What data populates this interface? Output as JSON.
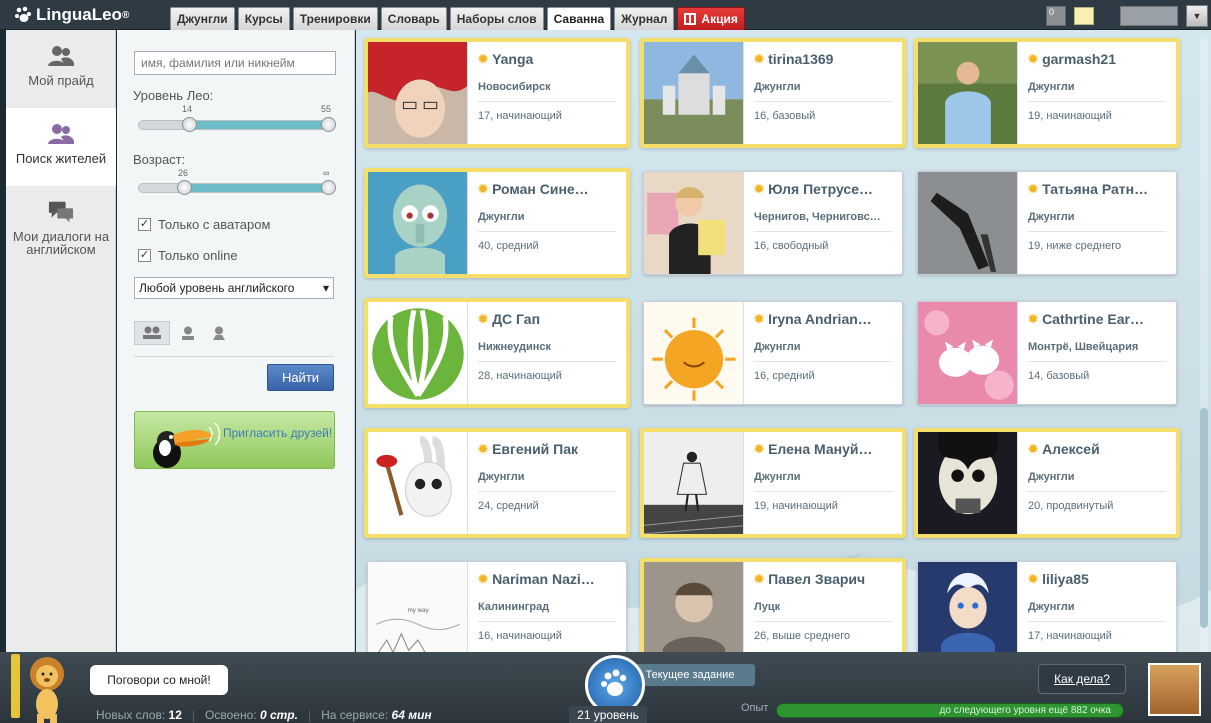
{
  "app": {
    "title": "LinguaLeo",
    "reg": "®"
  },
  "tabs": [
    {
      "label": "Джунгли"
    },
    {
      "label": "Курсы"
    },
    {
      "label": "Тренировки"
    },
    {
      "label": "Словарь"
    },
    {
      "label": "Наборы слов"
    },
    {
      "label": "Саванна"
    },
    {
      "label": "Журнал"
    },
    {
      "label": "Акция"
    }
  ],
  "topbar": {
    "notif_count": "0"
  },
  "nav": {
    "pride": "Мой прайд",
    "search": "Поиск жителей",
    "dialogs": "Мои диалоги на английском"
  },
  "filter": {
    "search_placeholder": "имя, фамилия или никнейм",
    "leo_label": "Уровень Лео:",
    "leo_min": "14",
    "leo_max": "55",
    "age_label": "Возраст:",
    "age_min": "26",
    "age_max": "∞",
    "with_avatar": "Только с аватаром",
    "only_online": "Только online",
    "english_level": "Любой уровень английского",
    "find": "Найти",
    "invite": "Пригласить друзей!"
  },
  "colors": {
    "gold_border": "#f5df6a",
    "accent_teal": "#6fbcc9",
    "button_blue": "#3a64a8",
    "promo_red": "#c11d1d",
    "xp_green": "#2e9432"
  },
  "people": [
    {
      "name": "Yanga",
      "city": "Новосибирск",
      "level": "17, начинающий",
      "gold": true,
      "photo": "anime-red-hair"
    },
    {
      "name": "tirina1369",
      "city": "Джунгли",
      "level": "16, базовый",
      "gold": true,
      "photo": "castle"
    },
    {
      "name": "garmash21",
      "city": "Джунгли",
      "level": "19, начинающий",
      "gold": true,
      "photo": "man-outdoor"
    },
    {
      "name": "Роман Сине…",
      "city": "Джунгли",
      "level": "40, средний",
      "gold": true,
      "photo": "squidward"
    },
    {
      "name": "Юля Петрусе…",
      "city": "Чернигов, Черниговс…",
      "level": "16, свободный",
      "gold": false,
      "photo": "girl-book"
    },
    {
      "name": "Татьяна Ратн…",
      "city": "Джунгли",
      "level": "19, ниже среднего",
      "gold": false,
      "photo": "heel-shoe"
    },
    {
      "name": "ДС Гап",
      "city": "Нижнеудинск",
      "level": "28, начинающий",
      "gold": true,
      "photo": "green-logo"
    },
    {
      "name": "Iryna Andrian…",
      "city": "Джунгли",
      "level": "16, средний",
      "gold": false,
      "photo": "sun-cartoon"
    },
    {
      "name": "Cathrtine Ear…",
      "city": "Монтрё, Швейцария",
      "level": "14, базовый",
      "gold": false,
      "photo": "kittens"
    },
    {
      "name": "Евгений Пак",
      "city": "Джунгли",
      "level": "24, средний",
      "gold": true,
      "photo": "rabbid"
    },
    {
      "name": "Елена Мануй…",
      "city": "Джунгли",
      "level": "19, начинающий",
      "gold": true,
      "photo": "bw-girl-rails"
    },
    {
      "name": "Алексей",
      "city": "Джунгли",
      "level": "20, продвинутый",
      "gold": true,
      "photo": "monster-mask"
    },
    {
      "name": "Nariman Nazi…",
      "city": "Калининград",
      "level": "16, начинающий",
      "gold": false,
      "photo": "sketch"
    },
    {
      "name": "Павел Зварич",
      "city": "Луцк",
      "level": "26, выше среднего",
      "gold": true,
      "photo": "boy-portrait"
    },
    {
      "name": "liliya85",
      "city": "Джунгли",
      "level": "17, начинающий",
      "gold": false,
      "photo": "jack-frost"
    }
  ],
  "footer": {
    "talk": "Поговори со мной!",
    "new_words_label": "Новых слов:",
    "new_words": "12",
    "learned_label": "Освоено:",
    "learned": "0 стр.",
    "time_label": "На сервисе:",
    "time": "64 мин",
    "task": "Текущее задание",
    "level": "21 уровень",
    "xp_label": "Опыт",
    "xp_text": "до следующего уровня ещё 882 очка",
    "xp_progress": 1.0,
    "how": "Как дела?"
  }
}
